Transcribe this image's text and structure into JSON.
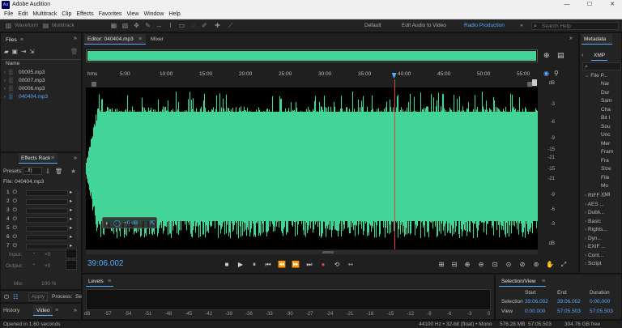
{
  "window": {
    "app_logo": "Au",
    "title": "Adobe Audition",
    "controls": {
      "minimize": "—",
      "maximize": "☐",
      "close": "✕"
    }
  },
  "menu": [
    "File",
    "Edit",
    "Multitrack",
    "Clip",
    "Effects",
    "Favorites",
    "View",
    "Window",
    "Help"
  ],
  "toolbar": {
    "waveform_label": "Waveform",
    "multitrack_label": "Multitrack",
    "workspaces": [
      "Default",
      "Edit Audio to Video",
      "Radio Production"
    ],
    "active_workspace": "Radio Production",
    "more": "»",
    "search_placeholder": "Search Help"
  },
  "files_panel": {
    "title": "Files",
    "column_name": "Name",
    "items": [
      {
        "name": "00005.mp3",
        "selected": false
      },
      {
        "name": "00007.mp3",
        "selected": false
      },
      {
        "name": "00006.mp3",
        "selected": false
      },
      {
        "name": "040404.mp3",
        "selected": true
      }
    ]
  },
  "effects_rack": {
    "title": "Effects Rack",
    "presets_label": "Presets:",
    "presets_value": "..ll)",
    "file_label": "File: 040404.mp3",
    "slots": [
      "1",
      "2",
      "3",
      "4",
      "5",
      "6",
      "7"
    ],
    "input_label": "Input:",
    "input_value": "+0",
    "output_label": "Output:",
    "output_value": "+0",
    "mix_label": "Mix:",
    "mix_value": "100 %",
    "apply_label": "Apply",
    "process_label": "Process:",
    "process_value": "Se"
  },
  "bottom_left_tabs": [
    "History",
    "Video"
  ],
  "editor": {
    "tab_label": "Editor: 040404.mp3",
    "mixer_label": "Mixer",
    "ruler_unit": "hms",
    "ruler_labels": [
      "5:00",
      "10:00",
      "15:00",
      "20:00",
      "25:00",
      "30:00",
      "35:00",
      "40:00",
      "45:00",
      "50:00",
      "55:00"
    ],
    "db_labels_top": [
      "dB",
      "-3",
      "-6",
      "-9",
      "-15",
      "-21"
    ],
    "db_labels_bottom": [
      "-15",
      "-21",
      "-9",
      "-6",
      "-3",
      "dB"
    ],
    "hud_value": "+0 dB",
    "current_time": "39:06.002",
    "playhead_fraction": 0.682,
    "wave_color": "#43d498"
  },
  "metadata": {
    "title": "Metadata",
    "tab": "XMP",
    "section": "File P...",
    "fields": [
      "Nar",
      "Dur",
      "Sam",
      "Cha",
      "Bit I",
      "Sou",
      "Unc",
      "Mer",
      "Fram",
      "Fra",
      "Size",
      "File",
      "Mo",
      "XMI"
    ],
    "groups": [
      "RIFF ...",
      "AES ...",
      "Dubli...",
      "Basic",
      "Rights...",
      "Dyn...",
      "EXIF ...",
      "Cont...",
      "Script"
    ]
  },
  "levels": {
    "title": "Levels",
    "scale": [
      "dB",
      "-57",
      "-54",
      "-51",
      "-48",
      "-45",
      "-42",
      "-39",
      "-36",
      "-33",
      "-30",
      "-27",
      "-24",
      "-21",
      "-18",
      "-15",
      "-12",
      "-9",
      "-6",
      "-3",
      "0"
    ]
  },
  "selection_view": {
    "title": "Selection/View",
    "col_start": "Start",
    "col_end": "End",
    "col_duration": "Duration",
    "selection_label": "Selection",
    "selection_start": "39:06.002",
    "selection_end": "39:06.002",
    "selection_duration": "0:00.000",
    "view_label": "View",
    "view_start": "0:00.000",
    "view_end": "57:05.503",
    "view_duration": "57:05.503"
  },
  "status": {
    "left": "Opened in 1.60 seconds",
    "format": "44100 Hz • 32-bit (float) • Mono",
    "size": "576.28 MB",
    "duration": "57:05.503",
    "free": "304.76 GB free"
  }
}
